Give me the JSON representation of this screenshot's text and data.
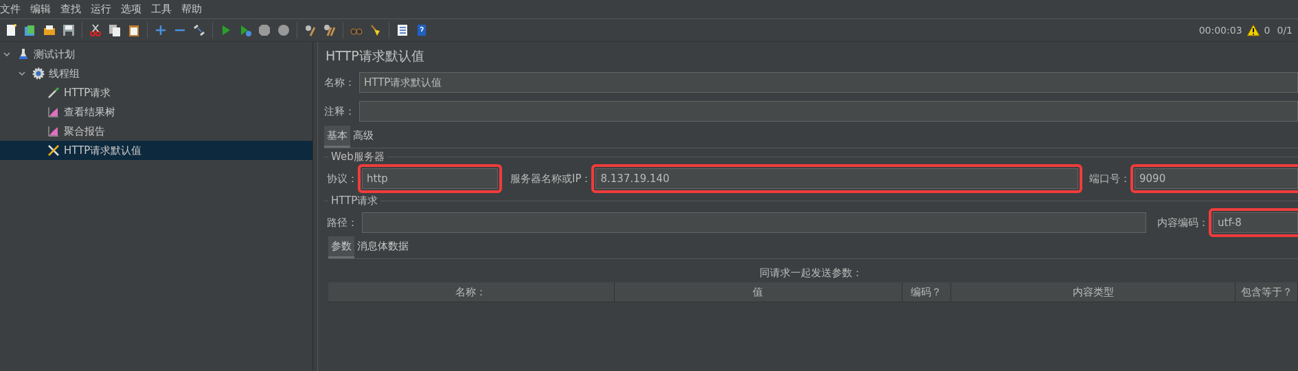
{
  "menu": [
    "文件",
    "编辑",
    "查找",
    "运行",
    "选项",
    "工具",
    "帮助"
  ],
  "status": {
    "time": "00:00:03",
    "warnings": "0",
    "threads": "0/1"
  },
  "tree": [
    {
      "label": "测试计划",
      "kind": "plan",
      "expanded": true,
      "selected": false,
      "children": [
        {
          "label": "线程组",
          "kind": "group",
          "expanded": true,
          "selected": false,
          "children": [
            {
              "label": "HTTP请求",
              "kind": "sampler",
              "selected": false
            },
            {
              "label": "查看结果树",
              "kind": "listener",
              "selected": false
            },
            {
              "label": "聚合报告",
              "kind": "listener",
              "selected": false
            },
            {
              "label": "HTTP请求默认值",
              "kind": "config",
              "selected": true
            }
          ]
        }
      ]
    }
  ],
  "panel": {
    "title": "HTTP请求默认值",
    "name": {
      "label": "名称：",
      "value": "HTTP请求默认值"
    },
    "comment": {
      "label": "注释："
    },
    "tabs": [
      {
        "label": "基本",
        "selected": true
      },
      {
        "label": "高级",
        "selected": false
      }
    ],
    "web_server": {
      "legend": "Web服务器",
      "protocol": {
        "label": "协议：",
        "value": "http",
        "highlighted": true
      },
      "server": {
        "label": "服务器名称或IP：",
        "value": "8.137.19.140",
        "highlighted": true
      },
      "port": {
        "label": "端口号：",
        "value": "9090",
        "highlighted": true
      }
    },
    "http_request": {
      "legend": "HTTP请求",
      "path": {
        "label": "路径：",
        "highlighted": false
      },
      "encoding": {
        "label": "内容编码：",
        "value": "utf-8",
        "highlighted": true
      }
    },
    "param_tabs": [
      {
        "label": "参数",
        "selected": true
      },
      {
        "label": "消息体数据",
        "selected": false
      }
    ],
    "table": {
      "caption": "同请求一起发送参数：",
      "columns": [
        "名称：",
        "值",
        "编码？",
        "内容类型",
        "包含等于？"
      ]
    }
  }
}
